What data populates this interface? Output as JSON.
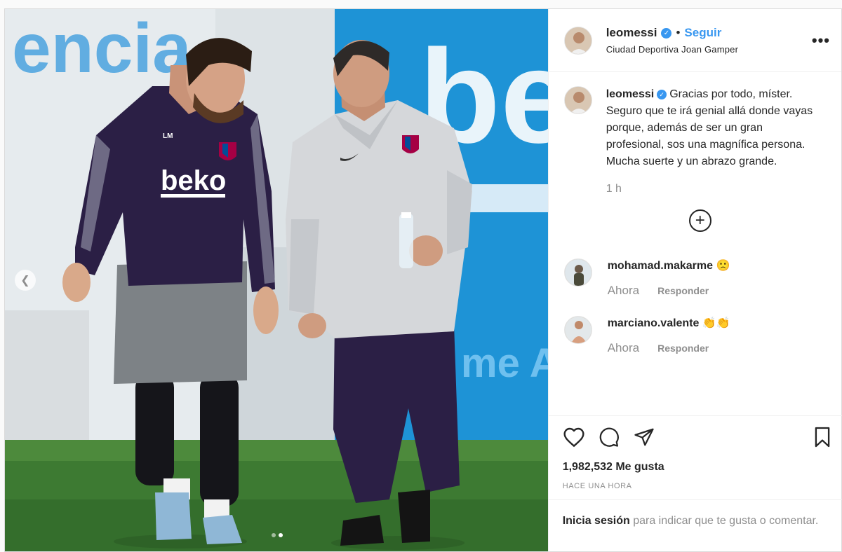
{
  "post": {
    "username": "leomessi",
    "follow_label": "Seguir",
    "location": "Ciudad Deportiva Joan Gamper",
    "more_label": "•••",
    "caption": "Gracias por todo, míster. Seguro que te irá genial allá donde vayas porque, además de ser un gran profesional, sos una magnífica persona. Mucha suerte y un abrazo grande.",
    "caption_time": "1 h",
    "load_more_label": "+",
    "likes": "1,982,532 Me gusta",
    "posted_time": "HACE UNA HORA",
    "login_link": "Inicia sesión",
    "login_text": " para indicar que te gusta o comentar."
  },
  "media": {
    "sign_text": "encia",
    "sponsor_text": "beko",
    "banner_text": "me Ap",
    "shirt_sponsor": "beko",
    "shirt_initials": "LM",
    "carousel": {
      "current": 2,
      "total": 2
    }
  },
  "comments": [
    {
      "username": "mohamad.makarme",
      "text": "🙁",
      "time": "Ahora",
      "reply": "Responder"
    },
    {
      "username": "marciano.valente",
      "text": "👏👏",
      "time": "Ahora",
      "reply": "Responder"
    }
  ],
  "icons": [
    "verified-badge-icon",
    "plus-circle-icon",
    "heart-icon",
    "comment-icon",
    "share-icon",
    "bookmark-icon",
    "chevron-left-icon"
  ],
  "colors": {
    "link_blue": "#3897f0",
    "text": "#262626",
    "muted": "#8e8e8e",
    "border": "#dbdbdb"
  }
}
